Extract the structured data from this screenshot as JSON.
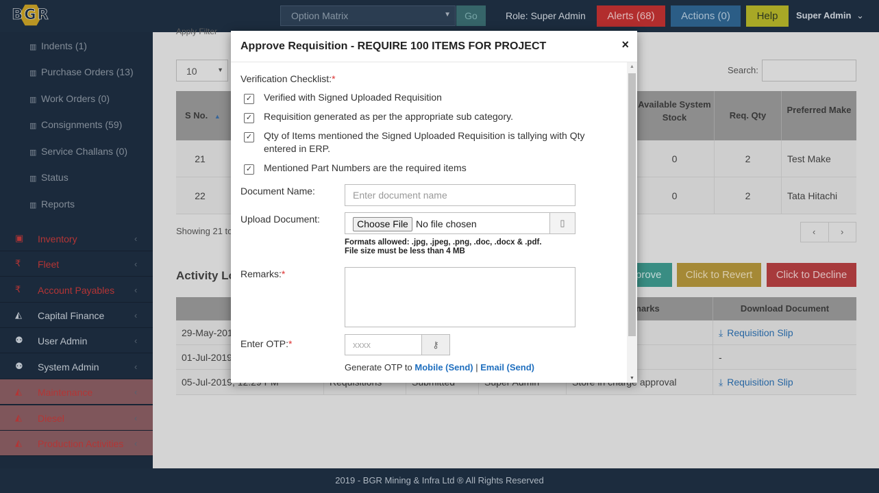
{
  "header": {
    "logo_text": "BGR",
    "option_select_value": "Option Matrix",
    "go_label": "Go",
    "role_text": "Role: Super Admin",
    "alerts_label": "Alerts (68)",
    "actions_label": "Actions (0)",
    "help_label": "Help",
    "user_label": "Super Admin"
  },
  "sidebar": {
    "sub_items": [
      {
        "label": "Indents (1)"
      },
      {
        "label": "Purchase Orders (13)"
      },
      {
        "label": "Work Orders (0)"
      },
      {
        "label": "Consignments (59)"
      },
      {
        "label": "Service Challans (0)"
      },
      {
        "label": "Status"
      },
      {
        "label": "Reports"
      }
    ],
    "main_items": [
      {
        "label": "Inventory",
        "icon": "box-icon"
      },
      {
        "label": "Fleet",
        "icon": "rupee-icon"
      },
      {
        "label": "Account Payables",
        "icon": "rupee-icon"
      },
      {
        "label": "Capital Finance",
        "icon": "area-chart-icon"
      },
      {
        "label": "User Admin",
        "icon": "users-icon"
      },
      {
        "label": "System Admin",
        "icon": "users-icon"
      },
      {
        "label": "Maintenance",
        "icon": "area-chart-icon"
      },
      {
        "label": "Diesel",
        "icon": "area-chart-icon"
      },
      {
        "label": "Production Activities",
        "icon": "area-chart-icon"
      }
    ]
  },
  "background_page": {
    "apply_filter_text": "Apply Filter",
    "per_page_value": "10",
    "search_label": "Search:",
    "table": {
      "headers": [
        "S No.",
        "Available System Stock",
        "Req. Qty",
        "Preferred Make"
      ],
      "rows": [
        {
          "sno": "21",
          "stock": "0",
          "qty": "2",
          "make": "Test Make"
        },
        {
          "sno": "22",
          "stock": "0",
          "qty": "2",
          "make": "Tata Hitachi"
        }
      ]
    },
    "showing_text": "Showing 21 to",
    "pager_prev": "‹",
    "pager_next": "›",
    "activity_title": "Activity Lo",
    "approve_label": "prove",
    "revert_label": "Click to Revert",
    "decline_label": "Click to Decline",
    "log_table": {
      "header_date": "D",
      "header_remarks": "narks",
      "header_download": "Download Document",
      "rows": [
        {
          "date": "29-May-201",
          "col2": "",
          "col3": "",
          "col4": "",
          "remarks": "",
          "download": "Requisition Slip"
        },
        {
          "date": "01-Jul-2019",
          "col2": "",
          "col3": "",
          "col4": "",
          "remarks": "",
          "download": "-"
        },
        {
          "date": "05-Jul-2019, 12:29 PM",
          "col2": "Requisitions",
          "col3": "Submitted",
          "col4": "Super Admin",
          "remarks": "Store in charge approval",
          "download": "Requisition Slip"
        }
      ]
    }
  },
  "modal": {
    "title": "Approve Requisition - REQUIRE 100 ITEMS FOR PROJECT",
    "close_label": "×",
    "checklist_label": "Verification Checklist:",
    "required_mark": "*",
    "checklist": [
      {
        "label": "Verified with Signed Uploaded Requisition",
        "checked": true
      },
      {
        "label": "Requisition generated as per the appropriate sub category.",
        "checked": true
      },
      {
        "label": "Qty of Items mentioned the Signed Uploaded Requisition is tallying with Qty entered in ERP.",
        "checked": true
      },
      {
        "label": "Mentioned Part Numbers are the required items",
        "checked": true
      }
    ],
    "document_name_label": "Document Name:",
    "document_name_placeholder": "Enter document name",
    "upload_label": "Upload Document:",
    "choose_file_label": "Choose File",
    "no_file_text": "No file chosen",
    "formats_hint": "Formats allowed: .jpg, .jpeg, .png, .doc, .docx & .pdf.",
    "size_hint": "File size must be less than 4 MB",
    "remarks_label": "Remarks:",
    "otp_label": "Enter OTP:",
    "otp_placeholder": "xxxx",
    "generate_otp_text": "Generate OTP to",
    "mobile_link": "Mobile (Send)",
    "separator": "|",
    "email_link": "Email (Send)"
  },
  "footer": {
    "text": "2019 - BGR Mining & Infra Ltd ® All Rights Reserved"
  }
}
